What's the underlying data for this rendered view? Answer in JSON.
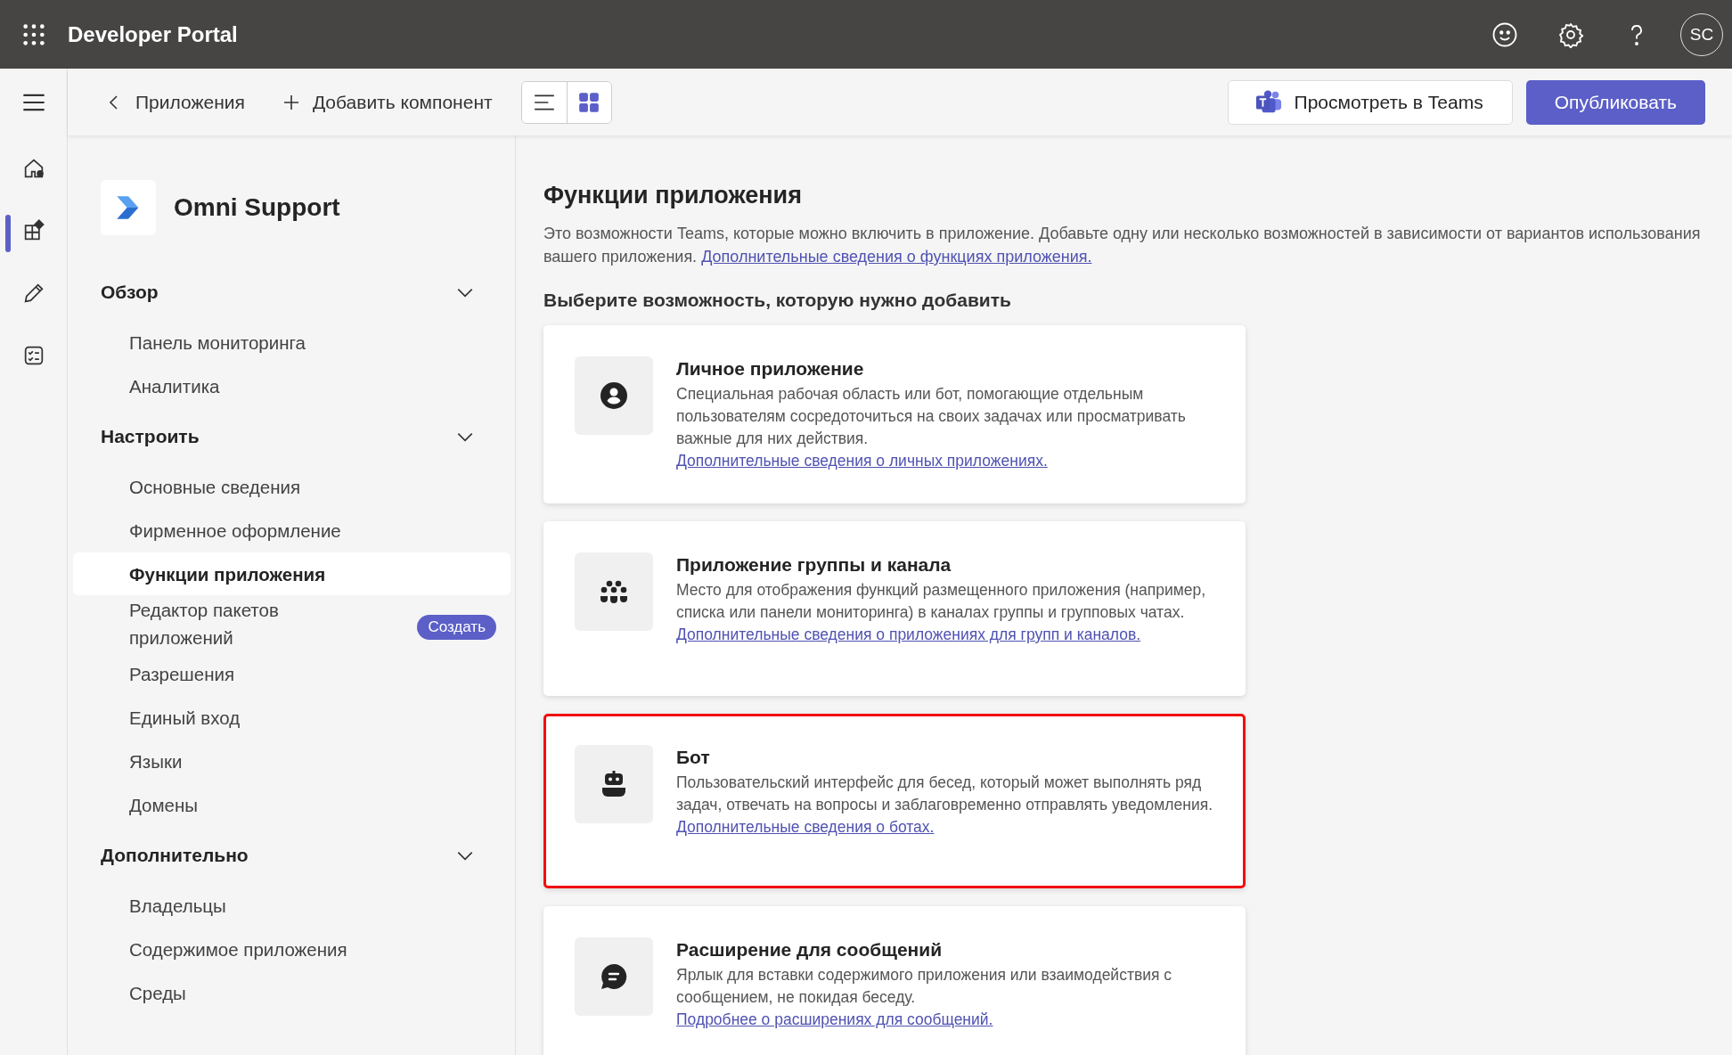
{
  "header": {
    "title": "Developer Portal",
    "avatar": "SC"
  },
  "toolbar": {
    "back": "Приложения",
    "add": "Добавить компонент",
    "views": [
      {
        "kind": "list",
        "selected": false
      },
      {
        "kind": "grid",
        "selected": true
      }
    ],
    "teams_button": "Просмотреть в Teams",
    "publish_button": "Опубликовать"
  },
  "rail": [
    {
      "kind": "home",
      "selected": false
    },
    {
      "kind": "apps",
      "selected": true
    },
    {
      "kind": "edit",
      "selected": false
    },
    {
      "kind": "checklist",
      "selected": false
    }
  ],
  "app": {
    "name": "Omni Support"
  },
  "nav": [
    {
      "title": "Обзор",
      "expanded": true,
      "items": [
        {
          "label": "Панель мониторинга",
          "selected": false
        },
        {
          "label": "Аналитика",
          "selected": false
        }
      ]
    },
    {
      "title": "Настроить",
      "expanded": true,
      "items": [
        {
          "label": "Основные сведения",
          "selected": false
        },
        {
          "label": "Фирменное оформление",
          "selected": false
        },
        {
          "label": "Функции приложения",
          "selected": true
        },
        {
          "label": "Редактор пакетов приложений",
          "selected": false,
          "badge": "Создать"
        },
        {
          "label": "Разрешения",
          "selected": false
        },
        {
          "label": "Единый вход",
          "selected": false
        },
        {
          "label": "Языки",
          "selected": false
        },
        {
          "label": "Домены",
          "selected": false
        }
      ]
    },
    {
      "title": "Дополнительно",
      "expanded": true,
      "items": [
        {
          "label": "Владельцы",
          "selected": false
        },
        {
          "label": "Содержимое приложения",
          "selected": false
        },
        {
          "label": "Среды",
          "selected": false
        }
      ]
    }
  ],
  "main": {
    "title": "Функции приложения",
    "intro": "Это возможности Teams, которые можно включить в приложение. Добавьте одну или несколько возможностей в зависимости от вариантов использования вашего приложения.",
    "intro_link": "Дополнительные сведения о функциях приложения.",
    "subtitle": "Выберите возможность, которую нужно добавить",
    "cards": [
      {
        "kind": "personal",
        "title": "Личное приложение",
        "description": "Специальная рабочая область или бот, помогающие отдельным пользователям сосредоточиться на своих задачах или просматривать важные для них действия.",
        "link": "Дополнительные сведения о личных приложениях.",
        "highlighted": false
      },
      {
        "kind": "team",
        "title": "Приложение группы и канала",
        "description": "Место для отображения функций размещенного приложения (например, списка или панели мониторинга) в каналах группы и групповых чатах.",
        "link": "Дополнительные сведения о приложениях для групп и каналов.",
        "highlighted": false
      },
      {
        "kind": "bot",
        "title": "Бот",
        "description": "Пользовательский интерфейс для бесед, который может выполнять ряд задач, отвечать на вопросы и заблаговременно отправлять уведомления.",
        "link": "Дополнительные сведения о ботах.",
        "highlighted": true
      },
      {
        "kind": "message",
        "title": "Расширение для сообщений",
        "description": "Ярлык для вставки содержимого приложения или взаимодействия с сообщением, не покидая беседу.",
        "link": "Подробнее о расширениях для сообщений.",
        "highlighted": false
      }
    ]
  }
}
